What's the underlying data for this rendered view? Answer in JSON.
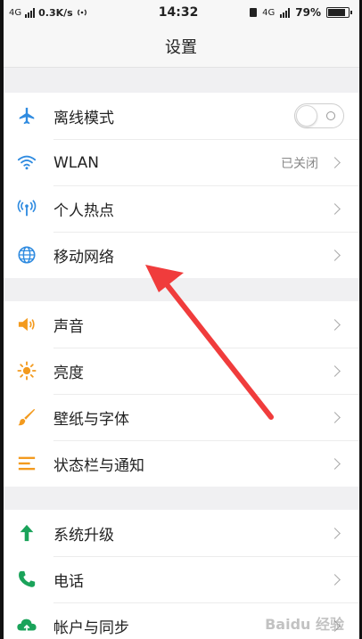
{
  "status_bar": {
    "network": "4G",
    "speed": "0.3K/s",
    "time": "14:32",
    "network_right": "4G",
    "battery": "79%"
  },
  "header": {
    "title": "设置"
  },
  "groups": [
    {
      "items": [
        {
          "label": "离线模式",
          "icon": "airplane-icon",
          "control": "toggle",
          "toggle_on": false
        },
        {
          "label": "WLAN",
          "icon": "wifi-icon",
          "value": "已关闭"
        },
        {
          "label": "个人热点",
          "icon": "hotspot-icon"
        },
        {
          "label": "移动网络",
          "icon": "globe-icon"
        }
      ]
    },
    {
      "items": [
        {
          "label": "声音",
          "icon": "speaker-icon"
        },
        {
          "label": "亮度",
          "icon": "sun-icon"
        },
        {
          "label": "壁纸与字体",
          "icon": "brush-icon"
        },
        {
          "label": "状态栏与通知",
          "icon": "list-icon"
        }
      ]
    },
    {
      "items": [
        {
          "label": "系统升级",
          "icon": "arrow-up-icon"
        },
        {
          "label": "电话",
          "icon": "phone-icon"
        },
        {
          "label": "帐户与同步",
          "icon": "cloud-icon"
        }
      ]
    }
  ],
  "watermark": "Baidu 经验",
  "colors": {
    "blue": "#2f8be0",
    "orange": "#f39a1e",
    "green": "#1aa35a",
    "arrow": "#f03c3c"
  }
}
